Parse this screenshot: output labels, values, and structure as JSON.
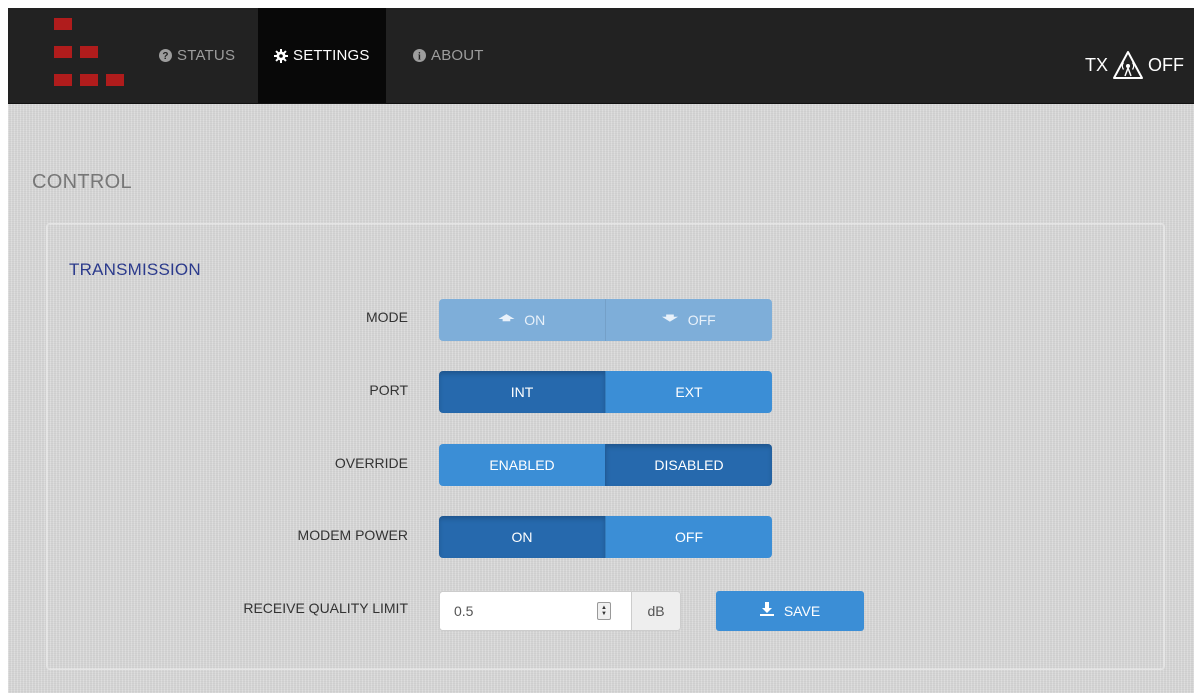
{
  "navbar": {
    "items": [
      {
        "label": "STATUS",
        "icon": "question-circle-icon",
        "active": false
      },
      {
        "label": "SETTINGS",
        "icon": "gear-icon",
        "active": true
      },
      {
        "label": "ABOUT",
        "icon": "info-circle-icon",
        "active": false
      }
    ],
    "tx_status": {
      "prefix": "TX",
      "icon": "antenna-warning-icon",
      "state": "OFF"
    },
    "logo_color": "#b01c1c"
  },
  "page": {
    "heading": "CONTROL"
  },
  "transmission": {
    "title": "TRANSMISSION",
    "mode": {
      "label": "MODE",
      "options": [
        {
          "label": "ON",
          "icon": "arrow-up-icon"
        },
        {
          "label": "OFF",
          "icon": "arrow-down-icon"
        }
      ]
    },
    "port": {
      "label": "PORT",
      "options": [
        "INT",
        "EXT"
      ],
      "selected": "INT"
    },
    "override": {
      "label": "OVERRIDE",
      "options": [
        "ENABLED",
        "DISABLED"
      ],
      "selected": "DISABLED"
    },
    "modem_power": {
      "label": "MODEM POWER",
      "options": [
        "ON",
        "OFF"
      ],
      "selected": "ON"
    },
    "receive_quality": {
      "label": "RECEIVE QUALITY LIMIT",
      "value": "0.5",
      "unit": "dB"
    },
    "save_label": "SAVE"
  },
  "colors": {
    "primary": "#3b8ed6",
    "primary_active": "#2669ad",
    "navbar_bg": "#222222",
    "title_blue": "#2b3a8c"
  }
}
